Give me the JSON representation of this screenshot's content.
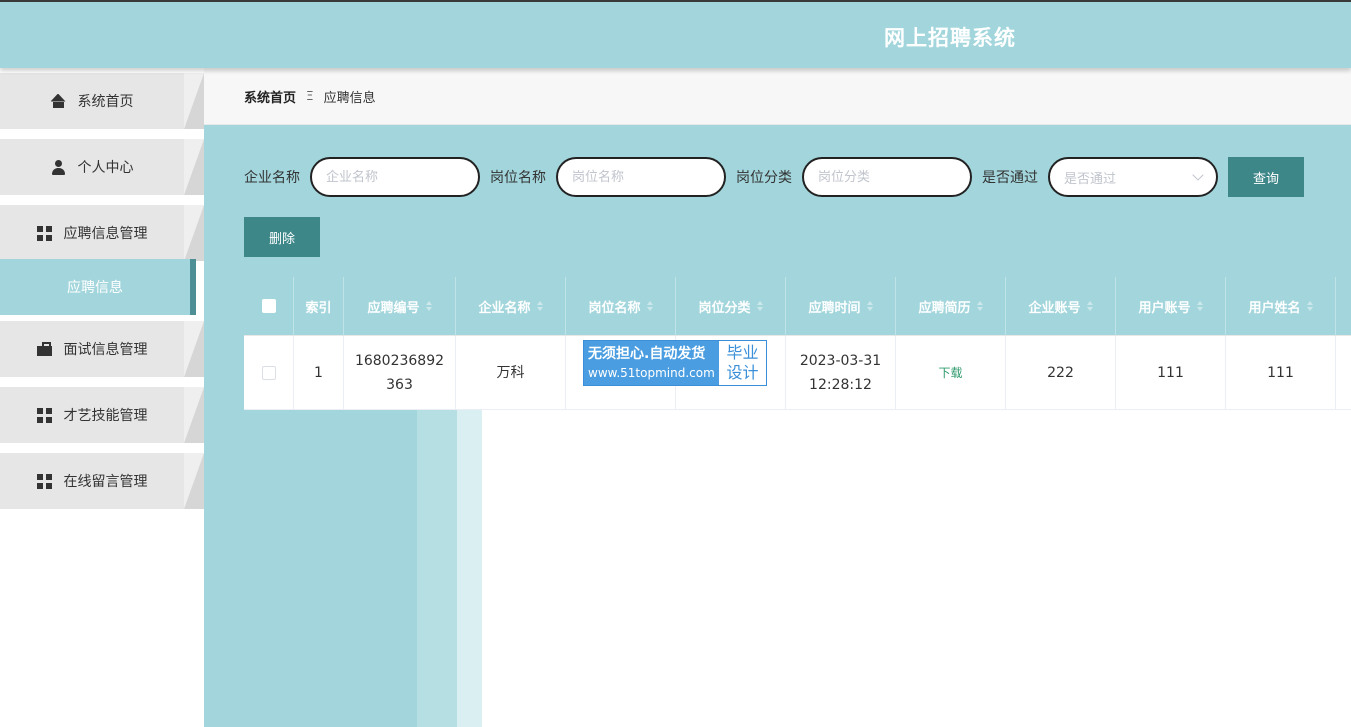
{
  "header": {
    "title": "网上招聘系统"
  },
  "sidebar": {
    "items": [
      {
        "label": "系统首页",
        "icon": "home-icon"
      },
      {
        "label": "个人中心",
        "icon": "user-icon"
      },
      {
        "label": "应聘信息管理",
        "icon": "grid-icon"
      },
      {
        "label": "应聘信息",
        "active": true
      },
      {
        "label": "面试信息管理",
        "icon": "briefcase-icon"
      },
      {
        "label": "才艺技能管理",
        "icon": "grid-icon"
      },
      {
        "label": "在线留言管理",
        "icon": "grid-icon"
      }
    ]
  },
  "breadcrumb": {
    "home": "系统首页",
    "separator": "Ξ",
    "current": "应聘信息"
  },
  "search": {
    "company_label": "企业名称",
    "company_placeholder": "企业名称",
    "position_label": "岗位名称",
    "position_placeholder": "岗位名称",
    "category_label": "岗位分类",
    "category_placeholder": "岗位分类",
    "approved_label": "是否通过",
    "approved_placeholder": "是否通过",
    "query_button": "查询"
  },
  "actions": {
    "delete_button": "删除"
  },
  "table": {
    "columns": [
      "索引",
      "应聘编号",
      "企业名称",
      "岗位名称",
      "岗位分类",
      "应聘时间",
      "应聘简历",
      "企业账号",
      "用户账号",
      "用户姓名"
    ],
    "rows": [
      {
        "index": "1",
        "application_no": "1680236892363",
        "company": "万科",
        "position": "",
        "category": "",
        "time": "2023-03-31 12:28:12",
        "resume": "下载",
        "company_account": "222",
        "user_account": "111",
        "user_name": "111"
      }
    ]
  },
  "watermark": {
    "line1": "无须担心.自动发货",
    "line2": "www.51topmind.com",
    "right_line1": "毕业",
    "right_line2": "设计"
  },
  "colors": {
    "theme": "#a2d6dc",
    "button": "#3e8789",
    "active_border": "#4d8f94",
    "download_link": "#2f9a6c"
  }
}
